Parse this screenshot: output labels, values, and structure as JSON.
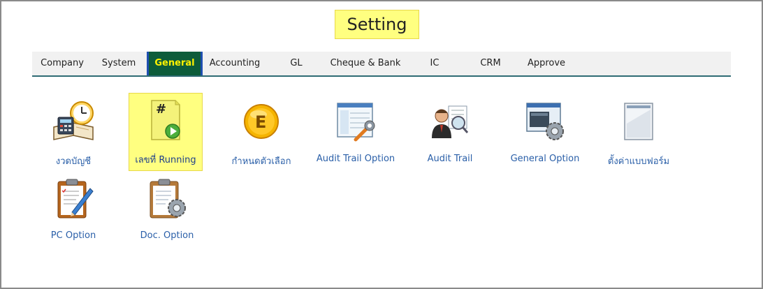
{
  "page": {
    "title": "Setting"
  },
  "tabs": [
    {
      "label": "Company"
    },
    {
      "label": "System"
    },
    {
      "label": "General"
    },
    {
      "label": "Accounting"
    },
    {
      "label": "GL"
    },
    {
      "label": "Cheque & Bank"
    },
    {
      "label": "IC"
    },
    {
      "label": "CRM"
    },
    {
      "label": "Approve"
    }
  ],
  "active_tab": "General",
  "items": [
    {
      "label": "งวดบัญชี",
      "icon": "calendar-calculator-icon"
    },
    {
      "label": "เลขที่ Running",
      "icon": "running-number-icon"
    },
    {
      "label": "กำหนดตัวเลือก",
      "icon": "option-e-icon"
    },
    {
      "label": "Audit Trail Option",
      "icon": "audit-trail-option-icon"
    },
    {
      "label": "Audit Trail",
      "icon": "audit-trail-icon"
    },
    {
      "label": "General Option",
      "icon": "general-option-icon"
    },
    {
      "label": "ตั้งค่าแบบฟอร์ม",
      "icon": "form-setting-icon"
    },
    {
      "label": "PC Option",
      "icon": "pc-option-icon"
    },
    {
      "label": "Doc. Option",
      "icon": "doc-option-icon"
    }
  ],
  "colors": {
    "accent": "#0d5c3a",
    "highlight": "#ffff80",
    "link": "#2a5fa8"
  }
}
